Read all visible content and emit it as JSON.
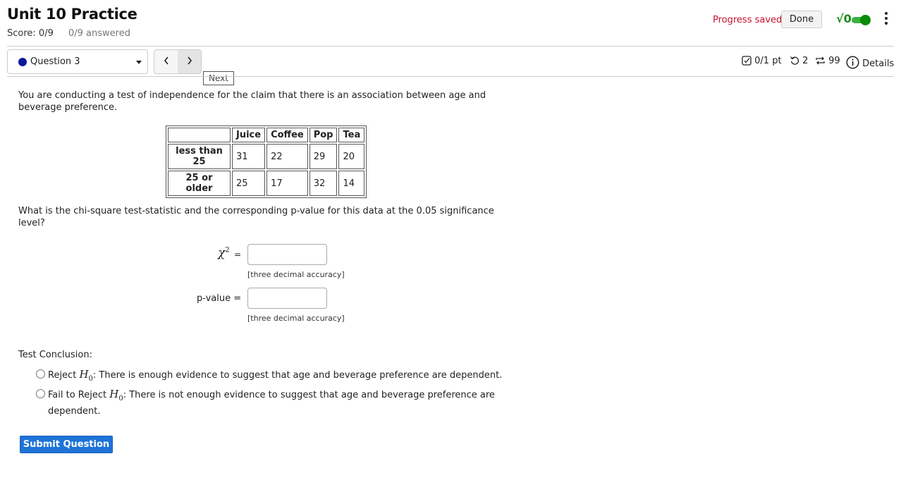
{
  "header": {
    "title": "Unit 10 Practice",
    "score": "Score: 0/9",
    "answered": "0/9 answered",
    "progress_status": "Progress saved",
    "done_label": "Done",
    "math_toggle_icon": "√0",
    "math_toggle_on": true
  },
  "question_nav": {
    "selected_question": "Question 3",
    "prev_icon": "‹",
    "next_icon": "›",
    "tooltip": "Next"
  },
  "meta": {
    "points": "0/1 pt",
    "retries": "2",
    "attempts": "99",
    "details": "Details"
  },
  "question": {
    "intro": "You are conducting a test of independence for the claim that there is an association between age and beverage preference.",
    "table": {
      "columns": [
        "",
        "Juice",
        "Coffee",
        "Pop",
        "Tea"
      ],
      "rows": [
        {
          "label": "less than 25",
          "values": [
            "31",
            "22",
            "29",
            "20"
          ]
        },
        {
          "label": "25 or older",
          "values": [
            "25",
            "17",
            "32",
            "14"
          ]
        }
      ]
    },
    "prompt": "What is the chi-square test-statistic and the corresponding p-value for this data at the 0.05 significance level?",
    "chi_label": "χ",
    "chi_sup": "2",
    "equals": "=",
    "chi_value": "",
    "pvalue_label": "p-value =",
    "pvalue_value": "",
    "hint": "[three decimal accuracy]",
    "conclusion_label": "Test Conclusion:",
    "options": [
      {
        "prefix": "Reject",
        "h": "H",
        "sub": "0",
        "text": ": There is enough evidence to suggest that age and beverage preference are dependent."
      },
      {
        "prefix": "Fail to Reject",
        "h": "H",
        "sub": "0",
        "text": ": There is not enough evidence to suggest that age and beverage preference are dependent."
      }
    ],
    "submit_label": "Submit Question"
  }
}
